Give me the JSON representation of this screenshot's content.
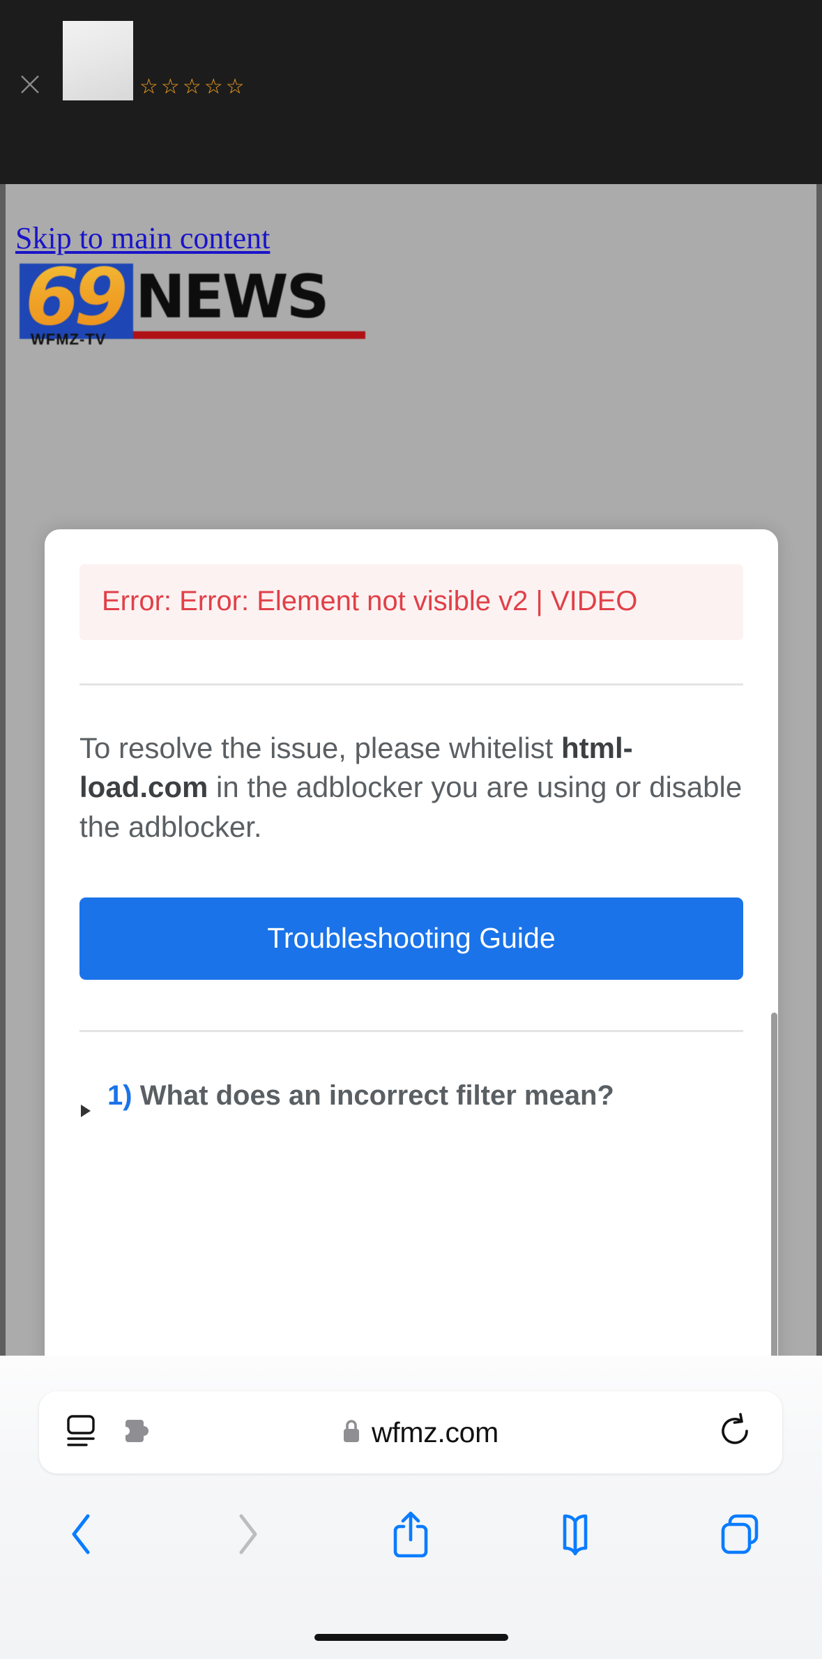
{
  "ad_banner": {
    "close_icon": "close-icon",
    "thumbnail": "ad-thumbnail",
    "rating_stars": [
      "☆",
      "☆",
      "☆",
      "☆",
      "☆"
    ],
    "rating_star_color": "#f5a01e",
    "background_color": "#1c1c1c"
  },
  "page": {
    "background_color": "#ababab",
    "skip_link": "Skip to main content",
    "logo": {
      "number": "69",
      "word": "NEWS",
      "station": "WFMZ-TV",
      "square_color": "#1e46b4",
      "number_color": "#f0a327",
      "bar_color": "#b01117"
    }
  },
  "modal": {
    "error": "Error: Error: Element not visible v2 | VIDEO",
    "error_color": "#e04048",
    "error_background": "#fdf2f2",
    "resolve": {
      "before": "To resolve the issue, please whitelist ",
      "domain": "html-load.com",
      "after": " in the adblocker you are using or disable the adblocker."
    },
    "button_label": "Troubleshooting Guide",
    "button_color": "#1a73e8",
    "faq": [
      {
        "number": "1)",
        "question": "What does an incorrect filter mean?",
        "marker": "triangle-right-icon",
        "expanded": false
      }
    ]
  },
  "browser": {
    "address_bar": {
      "reader_icon": "reader-view-icon",
      "extension_icon": "puzzle-piece-extension-icon",
      "lock_icon": "lock-icon",
      "url": "wfmz.com",
      "reload_icon": "reload-icon"
    },
    "toolbar": [
      {
        "name": "back-button",
        "icon": "chevron-left-icon",
        "enabled": true,
        "color": "#0a7cff"
      },
      {
        "name": "forward-button",
        "icon": "chevron-right-icon",
        "enabled": false,
        "color": "#bdbdbd"
      },
      {
        "name": "share-button",
        "icon": "share-icon",
        "enabled": true,
        "color": "#0a7cff"
      },
      {
        "name": "bookmarks-button",
        "icon": "book-icon",
        "enabled": true,
        "color": "#0a7cff"
      },
      {
        "name": "tabs-button",
        "icon": "tabs-icon",
        "enabled": true,
        "color": "#0a7cff"
      }
    ],
    "home_indicator": "home-indicator"
  }
}
